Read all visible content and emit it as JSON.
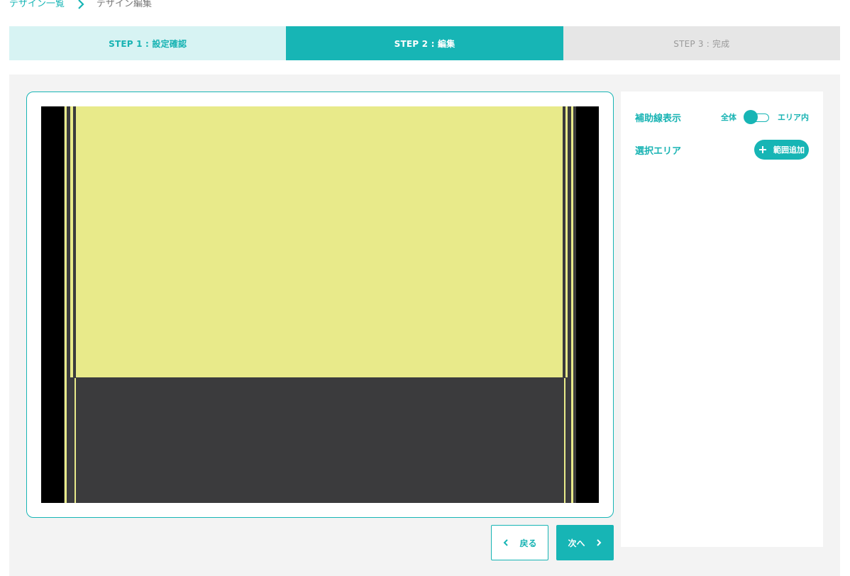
{
  "breadcrumb": {
    "parent": "デザイン一覧",
    "current": "デザイン編集",
    "separator_icon": "chevron-right-icon"
  },
  "steps": [
    {
      "label": "STEP 1 : 設定確認",
      "state": "done"
    },
    {
      "label": "STEP 2 : 編集",
      "state": "active"
    },
    {
      "label": "STEP 3 : 完成",
      "state": "pending"
    }
  ],
  "panel": {
    "guide_label": "補助線表示",
    "guide_option_all": "全体",
    "guide_option_area": "エリア内",
    "guide_selected": "全体",
    "area_label": "選択エリア",
    "add_button": "範囲追加",
    "add_icon": "plus-icon"
  },
  "nav": {
    "back": "戻る",
    "next": "次へ",
    "back_icon": "chevron-left-icon",
    "next_icon": "chevron-right-icon"
  },
  "colors": {
    "accent": "#17b5b5",
    "accent_light": "#d7f3f3",
    "canvas_yellow": "#e8ea8a",
    "canvas_dark": "#3b3b3d",
    "canvas_black": "#000000"
  }
}
